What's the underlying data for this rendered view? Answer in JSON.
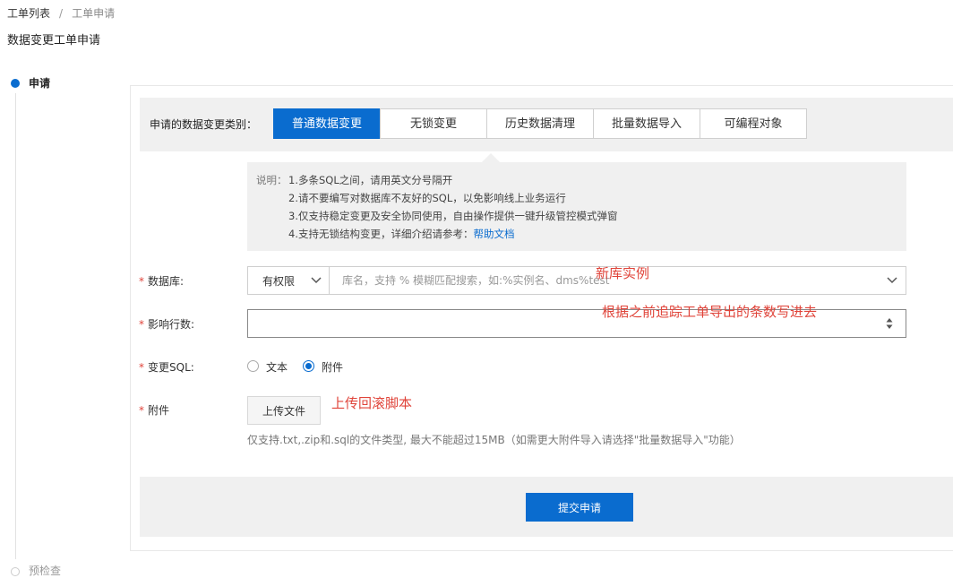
{
  "breadcrumb": {
    "items": [
      "工单列表",
      "工单申请"
    ],
    "separator": "/"
  },
  "page_title": "数据变更工单申请",
  "steps": [
    {
      "label": "申请",
      "state": "active"
    },
    {
      "label": "预检查",
      "state": "pending"
    }
  ],
  "change_type": {
    "label": "申请的数据变更类别：",
    "tabs": [
      "普通数据变更",
      "无锁变更",
      "历史数据清理",
      "批量数据导入",
      "可编程对象"
    ],
    "active_index": 0
  },
  "notice": {
    "prefix": "说明：",
    "lines": [
      "1.多条SQL之间，请用英文分号隔开",
      "2.请不要编写对数据库不友好的SQL，以免影响线上业务运行",
      "3.仅支持稳定变更及安全协同使用，自由操作提供一键升级管控模式弹窗",
      "4.支持无锁结构变更，详细介绍请参考："
    ],
    "link": "帮助文档"
  },
  "form": {
    "required_mark": "*",
    "database": {
      "label": "数据库:",
      "scope": "有权限",
      "placeholder": "库名，支持 % 模糊匹配搜索，如:%实例名、dms%test"
    },
    "affected_rows": {
      "label": "影响行数:",
      "value": ""
    },
    "change_sql": {
      "label": "变更SQL:",
      "options": [
        "文本",
        "附件"
      ],
      "selected": "附件"
    },
    "attachment": {
      "label": "附件",
      "button": "上传文件",
      "hint": "仅支持.txt,.zip和.sql的文件类型, 最大不能超过15MB（如需更大附件导入请选择\"批量数据导入\"功能）"
    }
  },
  "annotations": {
    "database": "新库实例",
    "rows": "根据之前追踪工单导出的条数写进去",
    "attachment": "上传回滚脚本"
  },
  "submit_label": "提交申请",
  "colors": {
    "primary": "#0a6ccf",
    "annotation": "#e0443a",
    "required": "#e0443a"
  },
  "icons": [
    "chevron-down-icon",
    "spinner-icon"
  ]
}
